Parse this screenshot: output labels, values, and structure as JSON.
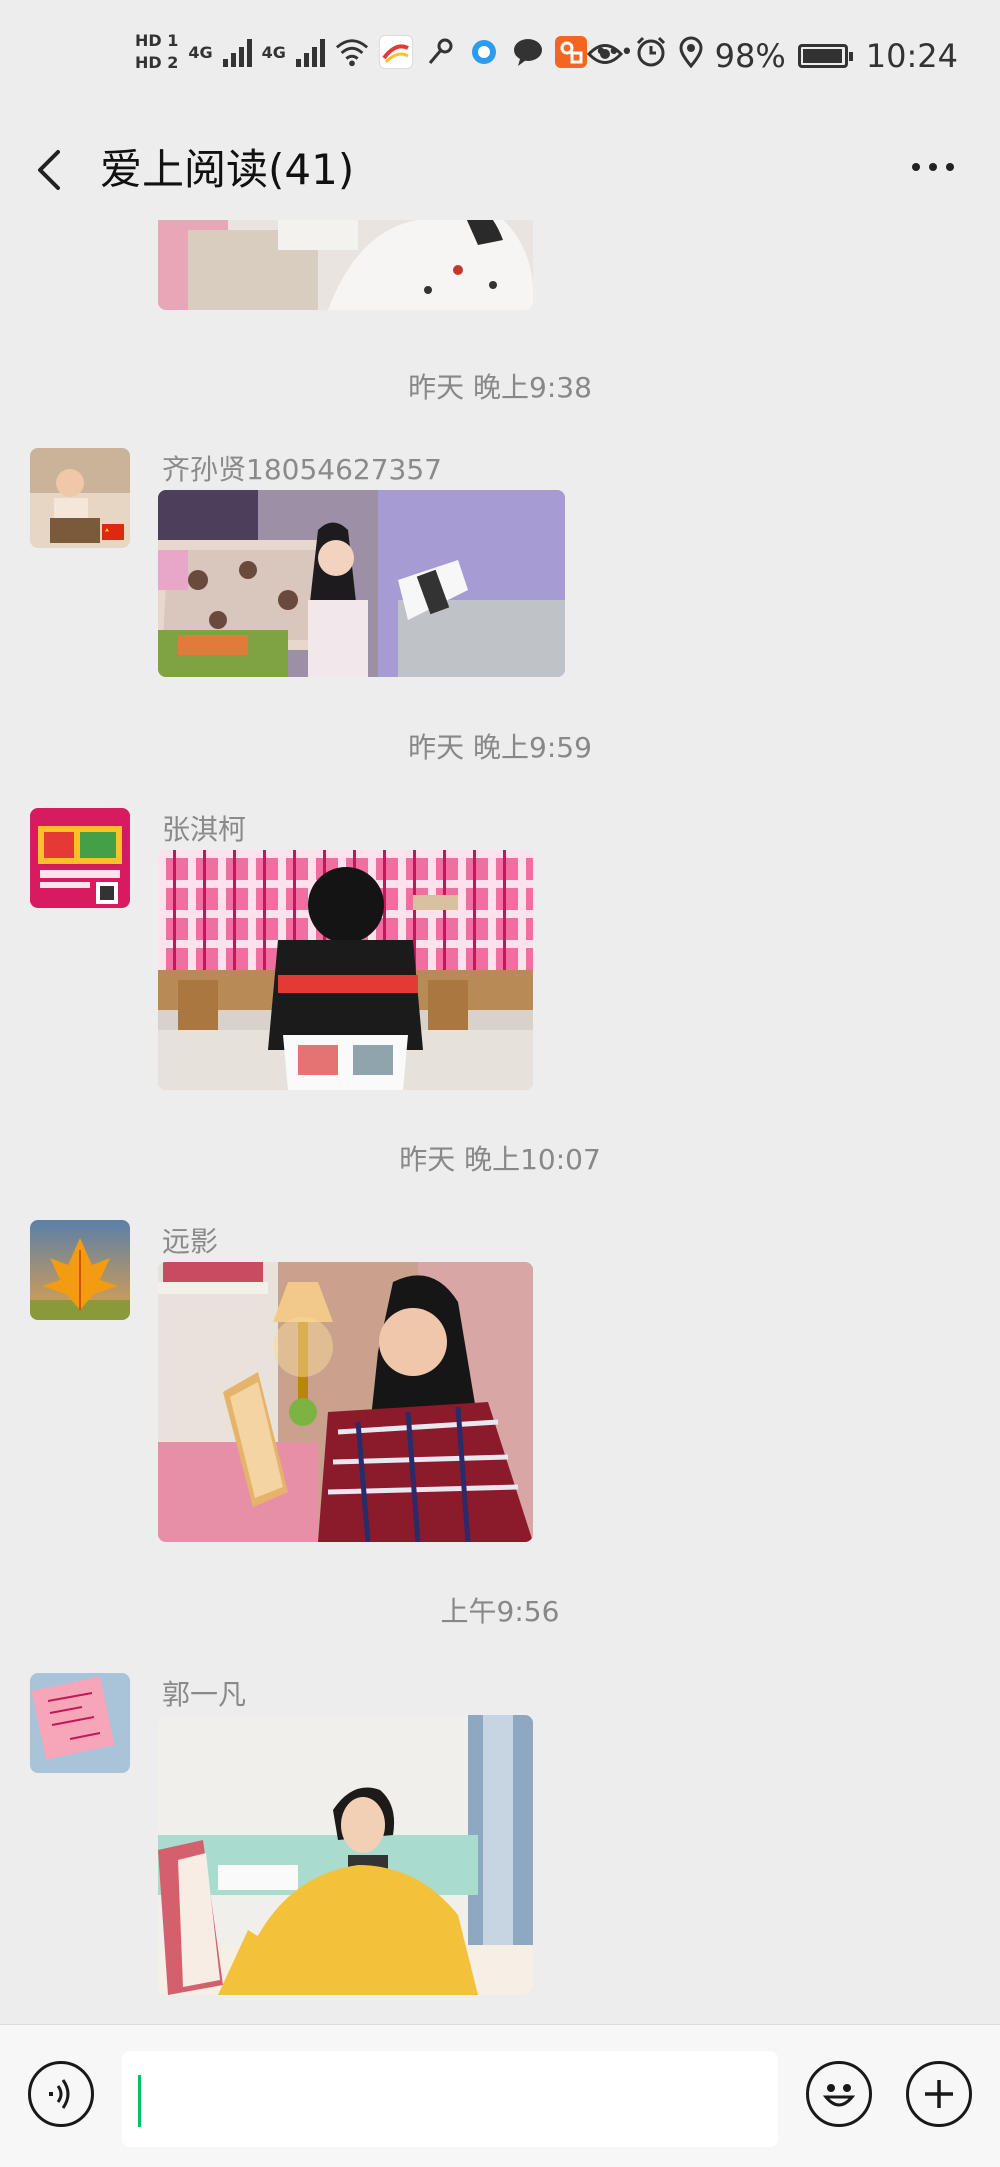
{
  "status_bar": {
    "sim1": "HD 1",
    "sim2": "HD 2",
    "network1": "4G",
    "network2": "4G",
    "battery_text": "98%",
    "battery_level": 0.98,
    "time": "10:24",
    "icons": [
      "signal-icon",
      "wifi-icon",
      "app-icon",
      "key-icon",
      "browser-icon",
      "chat-icon",
      "app-icon",
      "more-dots-icon",
      "eye-icon",
      "alarm-icon",
      "location-icon",
      "battery-icon"
    ]
  },
  "header": {
    "title": "爱上阅读(41)",
    "back_icon": "chevron-left-icon",
    "more_icon": "more-dots-icon"
  },
  "messages": [
    {
      "timestamp": "昨天 晚上9:38",
      "sender": "齐孙贤18054627357",
      "content": "photo"
    },
    {
      "timestamp": "昨天 晚上9:59",
      "sender": "张淇柯",
      "content": "photo"
    },
    {
      "timestamp": "昨天 晚上10:07",
      "sender": "远影",
      "content": "photo"
    },
    {
      "timestamp": "上午9:56",
      "sender": "郭一凡",
      "content": "photo"
    }
  ],
  "input_bar": {
    "voice_icon": "voice-icon",
    "emoji_icon": "emoji-icon",
    "plus_icon": "plus-icon",
    "text": "",
    "accent_color": "#07c160"
  }
}
